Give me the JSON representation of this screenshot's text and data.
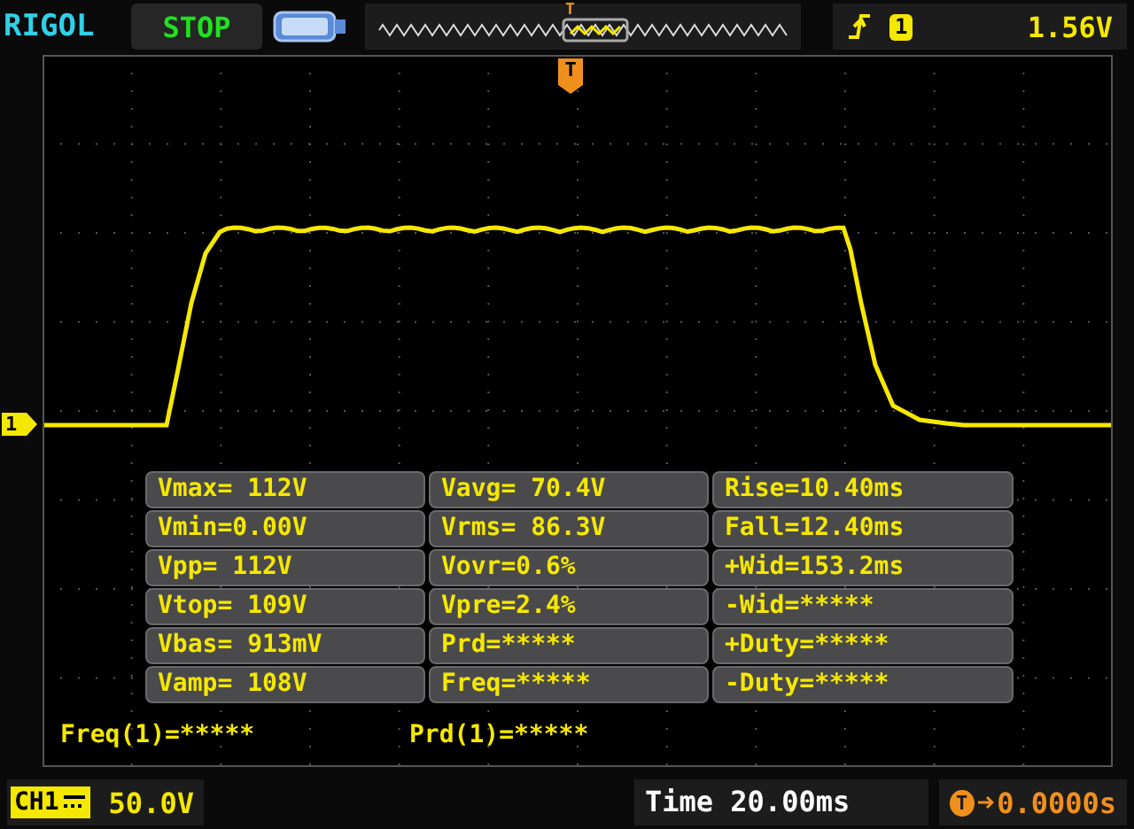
{
  "header": {
    "brand": "RIGOL",
    "run_state": "STOP",
    "memory_marker": "T",
    "trigger_channel": "1",
    "trigger_level": "1.56V"
  },
  "plot": {
    "trigger_marker": "T",
    "channel_marker": "1"
  },
  "measurements": [
    [
      "Vmax= 112V",
      "Vavg= 70.4V",
      "Rise=10.40ms"
    ],
    [
      "Vmin=0.00V",
      "Vrms= 86.3V",
      "Fall=12.40ms"
    ],
    [
      "Vpp= 112V",
      "Vovr=0.6%",
      "+Wid=153.2ms"
    ],
    [
      "Vtop= 109V",
      "Vpre=2.4%",
      "-Wid=*****"
    ],
    [
      "Vbas= 913mV",
      "Prd=*****",
      "+Duty=*****"
    ],
    [
      "Vamp= 108V",
      "Freq=*****",
      "-Duty=*****"
    ]
  ],
  "counters": [
    "Freq(1)=*****",
    "Prd(1)=*****"
  ],
  "footer": {
    "channel": "CH1",
    "scale": "50.0V",
    "timebase": "Time 20.00ms",
    "offset_marker": "T",
    "trigger_offset": "0.0000s"
  }
}
